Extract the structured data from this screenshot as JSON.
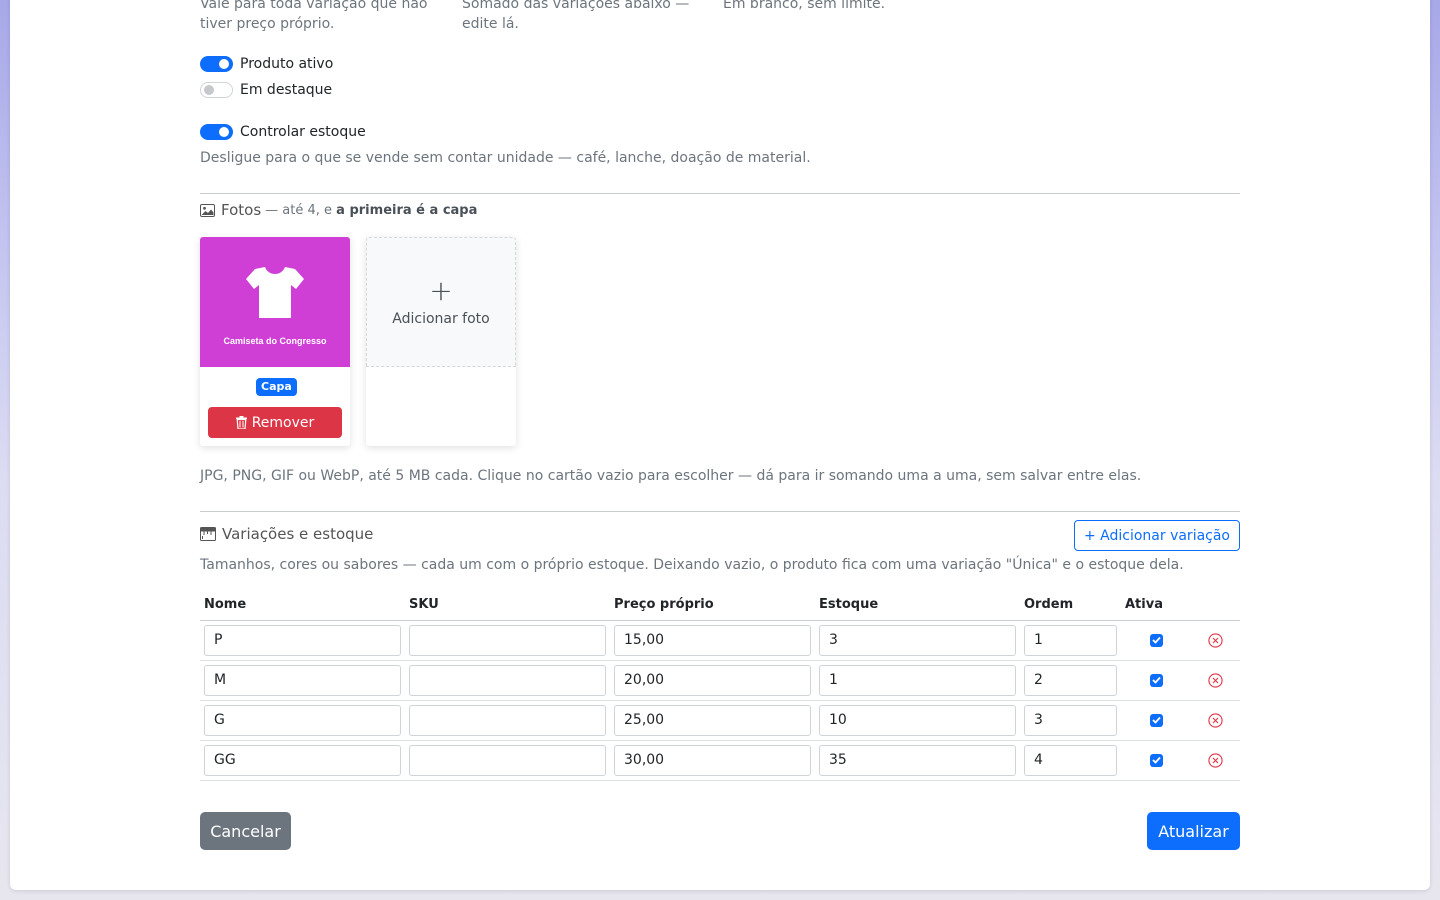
{
  "pricing": {
    "base_price_hint": "Vale para toda variação que não tiver preço próprio.",
    "stock_total_hint": "Somado das variações abaixo — edite lá.",
    "limit_hint": "Em branco, sem limite."
  },
  "toggles": {
    "active_label": "Produto ativo",
    "featured_label": "Em destaque",
    "stock_label": "Controlar estoque",
    "stock_hint": "Desligue para o que se vende sem contar unidade — café, lanche, doação de material."
  },
  "photos": {
    "title": "Fotos",
    "subtitle_prefix": "— até 4, e",
    "subtitle_bold": "a primeira é a capa",
    "items": [
      {
        "caption": "Camiseta do Congresso",
        "badge": "Capa",
        "remove_label": "Remover"
      }
    ],
    "add_label": "Adicionar foto",
    "add_symbol": "+",
    "hint": "JPG, PNG, GIF ou WebP, até 5 MB cada. Clique no cartão vazio para escolher — dá para ir somando uma a uma, sem salvar entre elas."
  },
  "variations": {
    "title": "Variações e estoque",
    "add_button": "+ Adicionar variação",
    "hint": "Tamanhos, cores ou sabores — cada um com o próprio estoque. Deixando vazio, o produto fica com uma variação \"Única\" e o estoque dela.",
    "columns": [
      "Nome",
      "SKU",
      "Preço próprio",
      "Estoque",
      "Ordem",
      "Ativa"
    ],
    "rows": [
      {
        "nome": "P",
        "sku": "",
        "preco": "15,00",
        "estoque": "3",
        "ordem": "1",
        "ativa": true
      },
      {
        "nome": "M",
        "sku": "",
        "preco": "20,00",
        "estoque": "1",
        "ordem": "2",
        "ativa": true
      },
      {
        "nome": "G",
        "sku": "",
        "preco": "25,00",
        "estoque": "10",
        "ordem": "3",
        "ativa": true
      },
      {
        "nome": "GG",
        "sku": "",
        "preco": "30,00",
        "estoque": "35",
        "ordem": "4",
        "ativa": true
      }
    ]
  },
  "actions": {
    "cancel": "Cancelar",
    "save": "Atualizar"
  },
  "colors": {
    "primary": "#0d6efd",
    "danger": "#dc3545",
    "secondary": "#6c757d",
    "photo_bg": "#d03fd5"
  }
}
